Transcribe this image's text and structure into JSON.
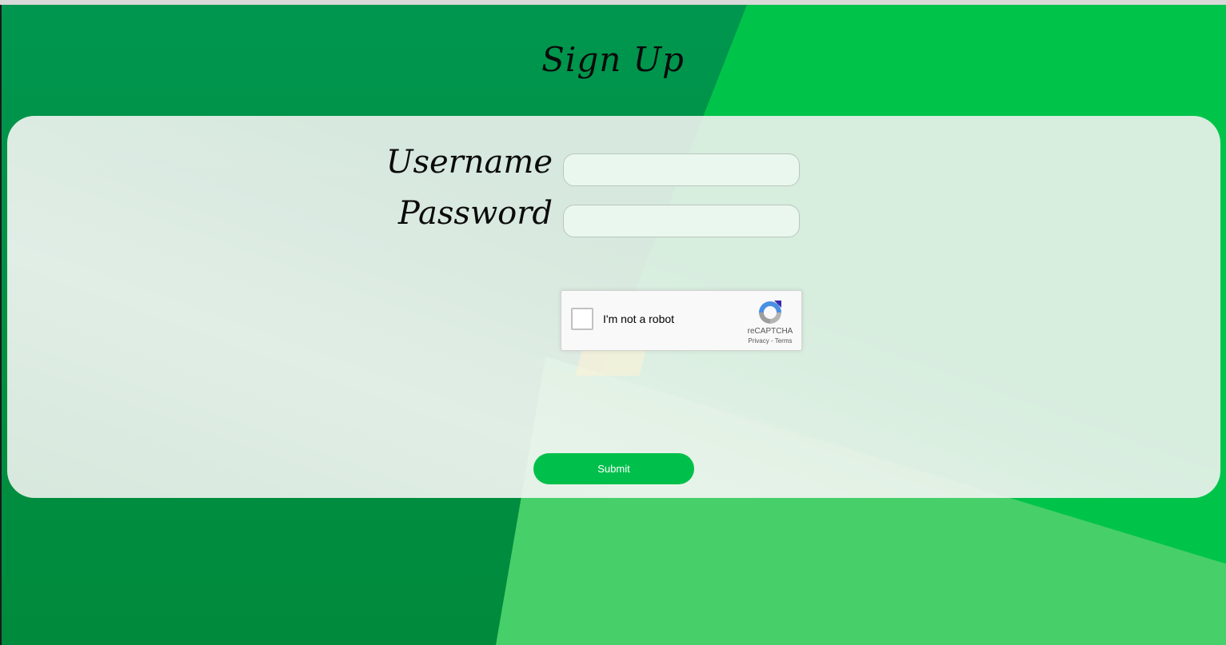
{
  "page": {
    "title": "Sign Up"
  },
  "form": {
    "username_label": "Username",
    "username_value": "",
    "password_label": "Password",
    "password_value": ""
  },
  "captcha": {
    "checkbox_label": "I'm not a robot",
    "brand": "reCAPTCHA",
    "privacy_link": "Privacy",
    "separator": "-",
    "terms_link": "Terms",
    "icon": "recaptcha-logo-icon"
  },
  "actions": {
    "submit_label": "Submit"
  },
  "colors": {
    "accent_green": "#00c04b",
    "background_dark_green": "#009244",
    "background_light_green": "#47cf6a"
  }
}
